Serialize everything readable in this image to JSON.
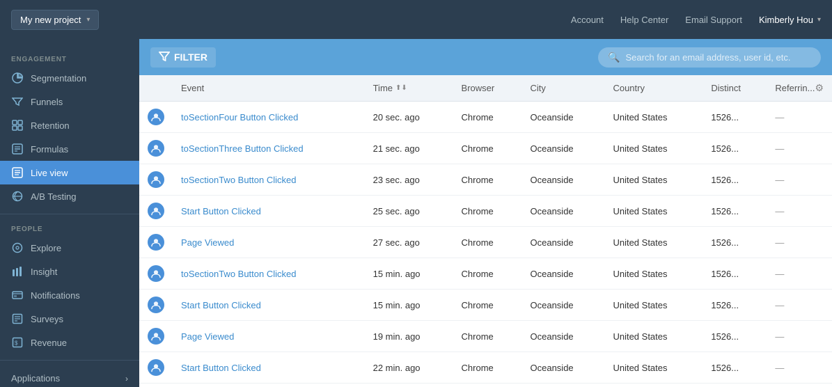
{
  "topNav": {
    "projectLabel": "My new project",
    "account": "Account",
    "helpCenter": "Help Center",
    "emailSupport": "Email Support",
    "userName": "Kimberly Hou"
  },
  "sidebar": {
    "engagementLabel": "ENGAGEMENT",
    "peopleLabel": "PEOPLE",
    "engagementItems": [
      {
        "id": "segmentation",
        "label": "Segmentation",
        "icon": "pie-chart"
      },
      {
        "id": "funnels",
        "label": "Funnels",
        "icon": "funnel"
      },
      {
        "id": "retention",
        "label": "Retention",
        "icon": "grid"
      },
      {
        "id": "formulas",
        "label": "Formulas",
        "icon": "formula"
      },
      {
        "id": "live-view",
        "label": "Live view",
        "icon": "live",
        "active": true
      },
      {
        "id": "ab-testing",
        "label": "A/B Testing",
        "icon": "ab"
      }
    ],
    "peopleItems": [
      {
        "id": "explore",
        "label": "Explore",
        "icon": "explore"
      },
      {
        "id": "insight",
        "label": "Insight",
        "icon": "insight"
      },
      {
        "id": "notifications",
        "label": "Notifications",
        "icon": "notifications"
      },
      {
        "id": "surveys",
        "label": "Surveys",
        "icon": "surveys"
      },
      {
        "id": "revenue",
        "label": "Revenue",
        "icon": "revenue"
      }
    ],
    "applicationsLabel": "Applications"
  },
  "filterBar": {
    "filterLabel": "FILTER",
    "searchPlaceholder": "Search for an email address, user id, etc."
  },
  "table": {
    "columns": [
      {
        "id": "avatar",
        "label": ""
      },
      {
        "id": "event",
        "label": "Event"
      },
      {
        "id": "time",
        "label": "Time",
        "sortable": true
      },
      {
        "id": "browser",
        "label": "Browser"
      },
      {
        "id": "city",
        "label": "City"
      },
      {
        "id": "country",
        "label": "Country"
      },
      {
        "id": "distinct",
        "label": "Distinct"
      },
      {
        "id": "referring",
        "label": "Referrin..."
      }
    ],
    "rows": [
      {
        "event": "toSectionFour Button Clicked",
        "time": "20 sec. ago",
        "browser": "Chrome",
        "city": "Oceanside",
        "country": "United States",
        "distinct": "1526...",
        "referring": "—"
      },
      {
        "event": "toSectionThree Button Clicked",
        "time": "21 sec. ago",
        "browser": "Chrome",
        "city": "Oceanside",
        "country": "United States",
        "distinct": "1526...",
        "referring": "—"
      },
      {
        "event": "toSectionTwo Button Clicked",
        "time": "23 sec. ago",
        "browser": "Chrome",
        "city": "Oceanside",
        "country": "United States",
        "distinct": "1526...",
        "referring": "—"
      },
      {
        "event": "Start Button Clicked",
        "time": "25 sec. ago",
        "browser": "Chrome",
        "city": "Oceanside",
        "country": "United States",
        "distinct": "1526...",
        "referring": "—"
      },
      {
        "event": "Page Viewed",
        "time": "27 sec. ago",
        "browser": "Chrome",
        "city": "Oceanside",
        "country": "United States",
        "distinct": "1526...",
        "referring": "—"
      },
      {
        "event": "toSectionTwo Button Clicked",
        "time": "15 min. ago",
        "browser": "Chrome",
        "city": "Oceanside",
        "country": "United States",
        "distinct": "1526...",
        "referring": "—"
      },
      {
        "event": "Start Button Clicked",
        "time": "15 min. ago",
        "browser": "Chrome",
        "city": "Oceanside",
        "country": "United States",
        "distinct": "1526...",
        "referring": "—"
      },
      {
        "event": "Page Viewed",
        "time": "19 min. ago",
        "browser": "Chrome",
        "city": "Oceanside",
        "country": "United States",
        "distinct": "1526...",
        "referring": "—"
      },
      {
        "event": "Start Button Clicked",
        "time": "22 min. ago",
        "browser": "Chrome",
        "city": "Oceanside",
        "country": "United States",
        "distinct": "1526...",
        "referring": "—"
      }
    ]
  }
}
